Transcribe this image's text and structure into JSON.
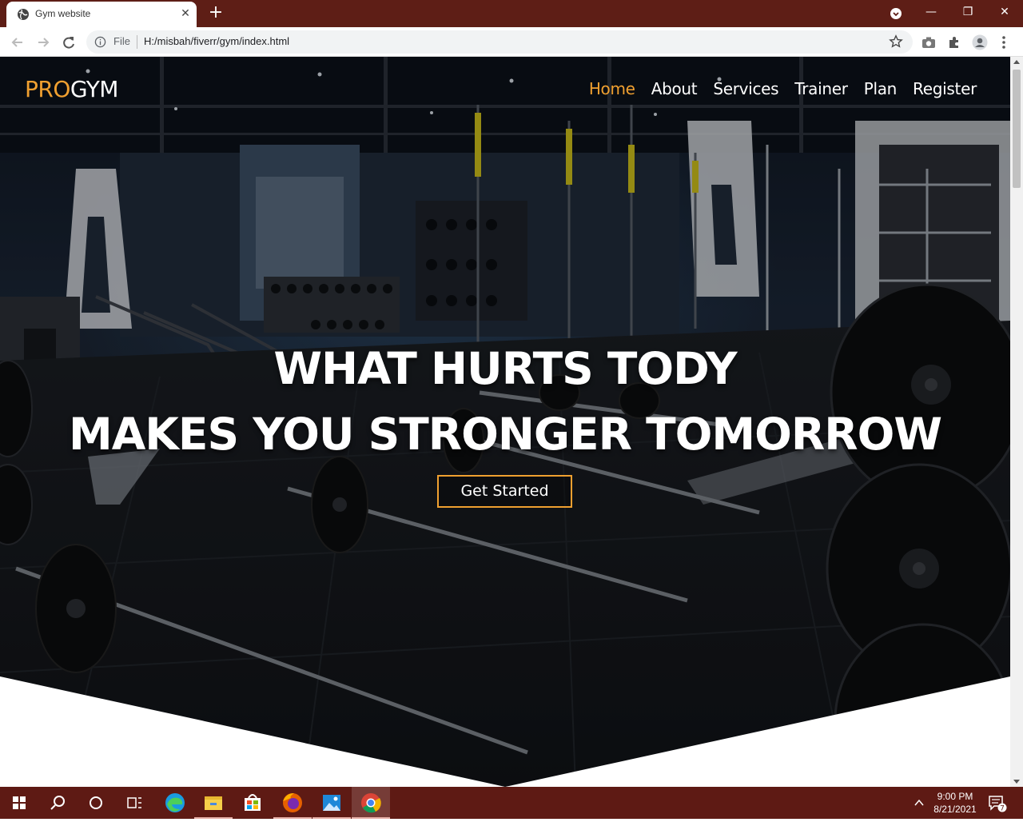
{
  "browser": {
    "tab_title": "Gym website",
    "omnibox_scheme": "File",
    "omnibox_url": "H:/misbah/fiverr/gym/index.html"
  },
  "site": {
    "logo_pro": "PRO",
    "logo_gym": "GYM",
    "nav": [
      {
        "label": "Home"
      },
      {
        "label": "About"
      },
      {
        "label": "Services"
      },
      {
        "label": "Trainer"
      },
      {
        "label": "Plan"
      },
      {
        "label": "Register"
      }
    ],
    "headline_line1": "WHAT HURTS TODY",
    "headline_line2": "MAKES YOU STRONGER TOMORROW",
    "cta_label": "Get Started",
    "colors": {
      "accent": "#f0a030",
      "chrome": "#5e1e16"
    }
  },
  "taskbar": {
    "time": "9:00 PM",
    "date": "8/21/2021",
    "notification_count": "7"
  }
}
